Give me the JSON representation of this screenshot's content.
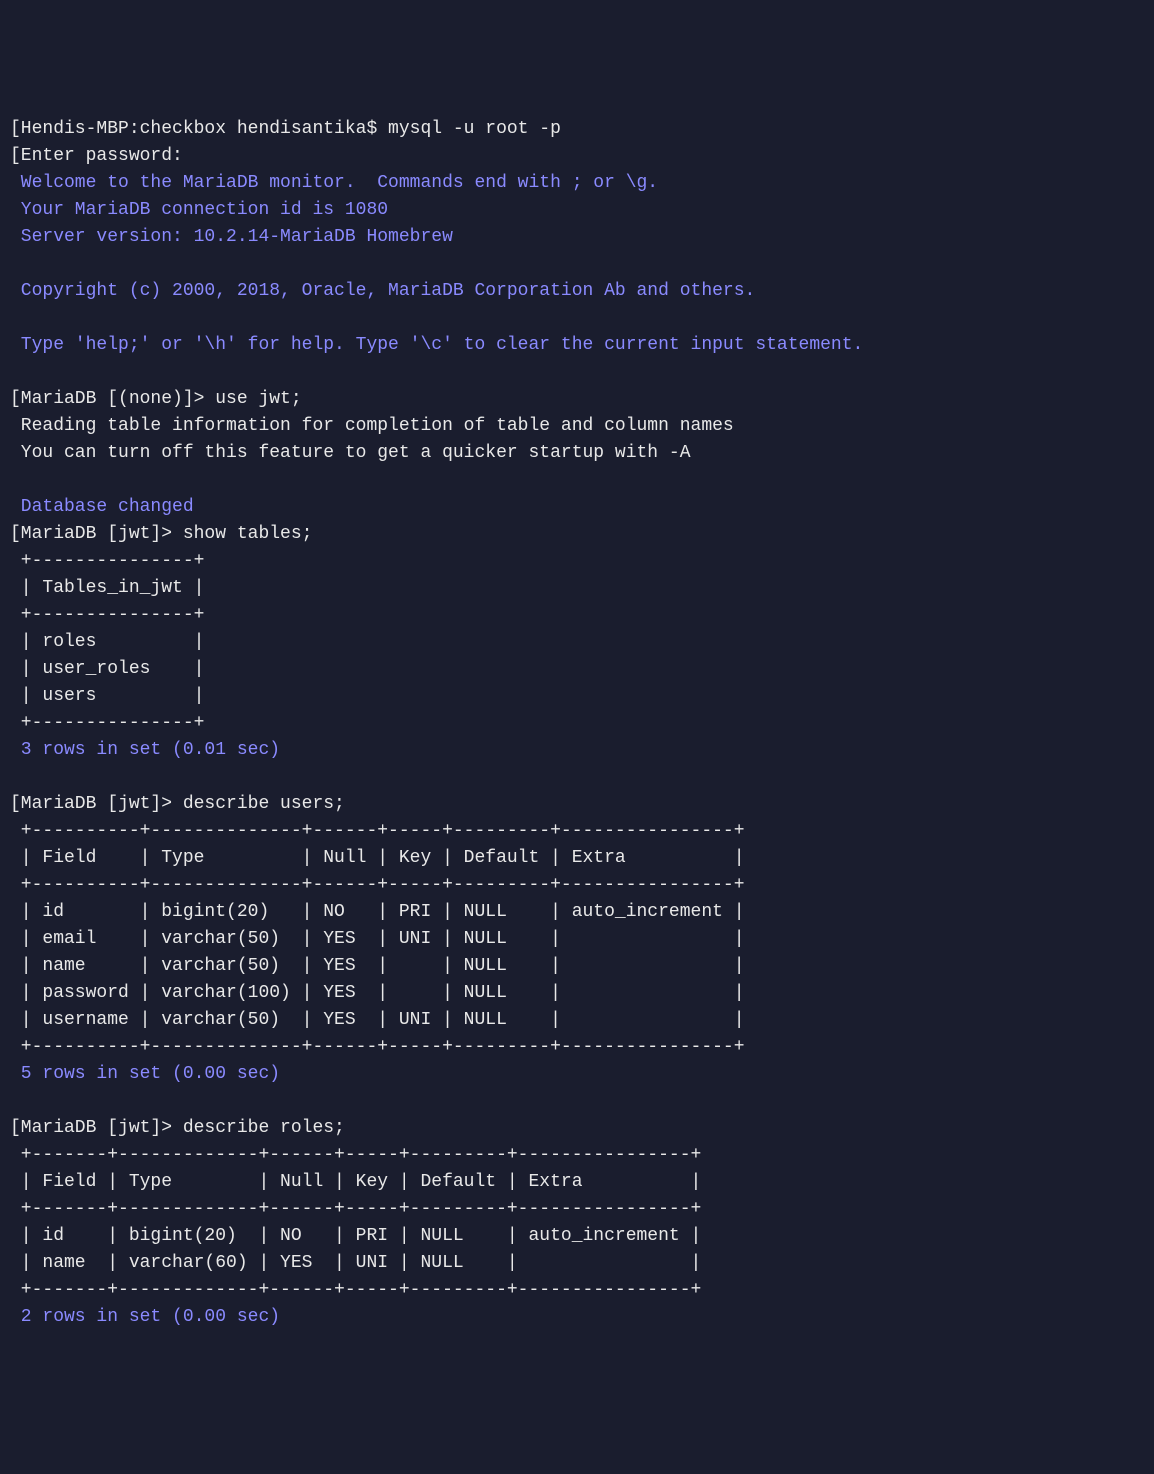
{
  "lines": {
    "login_prompt": "[Hendis-MBP:checkbox hendisantika$ mysql -u root -p",
    "enter_password": "[Enter password:",
    "welcome": " Welcome to the MariaDB monitor.  Commands end with ; or \\g.",
    "connection_id": " Your MariaDB connection id is 1080",
    "server_version": " Server version: 10.2.14-MariaDB Homebrew",
    "blank1": "",
    "copyright": " Copyright (c) 2000, 2018, Oracle, MariaDB Corporation Ab and others.",
    "blank2": "",
    "help_line": " Type 'help;' or '\\h' for help. Type '\\c' to clear the current input statement.",
    "blank3": "",
    "use_jwt_prompt": "[MariaDB [(none)]> use jwt;",
    "reading_table": " Reading table information for completion of table and column names",
    "turn_off": " You can turn off this feature to get a quicker startup with -A",
    "blank4": "",
    "db_changed": " Database changed",
    "show_tables_prompt": "[MariaDB [jwt]> show tables;",
    "tables_border1": " +---------------+",
    "tables_header": " | Tables_in_jwt |",
    "tables_border2": " +---------------+",
    "tables_row1": " | roles         |",
    "tables_row2": " | user_roles    |",
    "tables_row3": " | users         |",
    "tables_border3": " +---------------+",
    "tables_result": " 3 rows in set (0.01 sec)",
    "blank5": "",
    "desc_users_prompt": "[MariaDB [jwt]> describe users;",
    "users_border1": " +----------+--------------+------+-----+---------+----------------+",
    "users_header": " | Field    | Type         | Null | Key | Default | Extra          |",
    "users_border2": " +----------+--------------+------+-----+---------+----------------+",
    "users_row1": " | id       | bigint(20)   | NO   | PRI | NULL    | auto_increment |",
    "users_row2": " | email    | varchar(50)  | YES  | UNI | NULL    |                |",
    "users_row3": " | name     | varchar(50)  | YES  |     | NULL    |                |",
    "users_row4": " | password | varchar(100) | YES  |     | NULL    |                |",
    "users_row5": " | username | varchar(50)  | YES  | UNI | NULL    |                |",
    "users_border3": " +----------+--------------+------+-----+---------+----------------+",
    "users_result": " 5 rows in set (0.00 sec)",
    "blank6": "",
    "desc_roles_prompt": "[MariaDB [jwt]> describe roles;",
    "roles_border1": " +-------+-------------+------+-----+---------+----------------+",
    "roles_header": " | Field | Type        | Null | Key | Default | Extra          |",
    "roles_border2": " +-------+-------------+------+-----+---------+----------------+",
    "roles_row1": " | id    | bigint(20)  | NO   | PRI | NULL    | auto_increment |",
    "roles_row2": " | name  | varchar(60) | YES  | UNI | NULL    |                |",
    "roles_border3": " +-------+-------------+------+-----+---------+----------------+",
    "roles_result": " 2 rows in set (0.00 sec)"
  }
}
